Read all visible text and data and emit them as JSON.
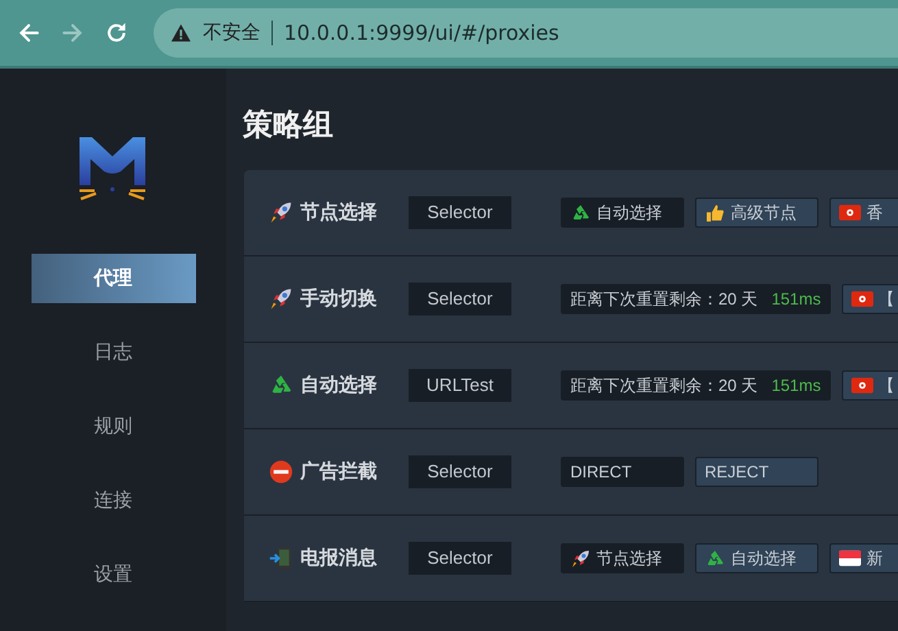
{
  "browser": {
    "nav": [
      {
        "kind": "back",
        "disabled": false
      },
      {
        "kind": "forward",
        "disabled": true
      },
      {
        "kind": "reload",
        "disabled": false
      }
    ],
    "security": "不安全",
    "url": "10.0.0.1:9999/ui/#/proxies"
  },
  "sidebar": {
    "items": [
      {
        "label": "代理",
        "selected": true
      },
      {
        "label": "日志",
        "selected": false
      },
      {
        "label": "规则",
        "selected": false
      },
      {
        "label": "连接",
        "selected": false
      },
      {
        "label": "设置",
        "selected": false
      }
    ]
  },
  "title": "策略组",
  "groups": [
    {
      "kind": "rocket",
      "name": "节点选择",
      "type": "Selector",
      "options": [
        {
          "kind": "recycle",
          "label": "自动选择",
          "selected": true
        },
        {
          "kind": "thumbs",
          "label": "高级节点",
          "selected": false
        },
        {
          "kind": "flag-hk",
          "label": "香",
          "selected": false
        }
      ]
    },
    {
      "kind": "rocket",
      "name": "手动切换",
      "type": "Selector",
      "options": [
        {
          "kind": "text",
          "label": "距离下次重置剩余：20 天",
          "delay": "151ms",
          "selected": true
        },
        {
          "kind": "flag-hk",
          "label": "【",
          "selected": false
        }
      ]
    },
    {
      "kind": "recycle",
      "name": "自动选择",
      "type": "URLTest",
      "options": [
        {
          "kind": "text",
          "label": "距离下次重置剩余：20 天",
          "delay": "151ms",
          "selected": true
        },
        {
          "kind": "flag-hk",
          "label": "【",
          "selected": false
        }
      ]
    },
    {
      "kind": "stop",
      "name": "广告拦截",
      "type": "Selector",
      "options": [
        {
          "kind": "text",
          "label": "DIRECT",
          "selected": true
        },
        {
          "kind": "text",
          "label": "REJECT",
          "selected": false
        }
      ]
    },
    {
      "kind": "phone",
      "name": "电报消息",
      "type": "Selector",
      "options": [
        {
          "kind": "rocket",
          "label": "节点选择",
          "selected": true
        },
        {
          "kind": "recycle",
          "label": "自动选择",
          "selected": false
        },
        {
          "kind": "flag-sg",
          "label": "新",
          "selected": false
        }
      ]
    }
  ]
}
